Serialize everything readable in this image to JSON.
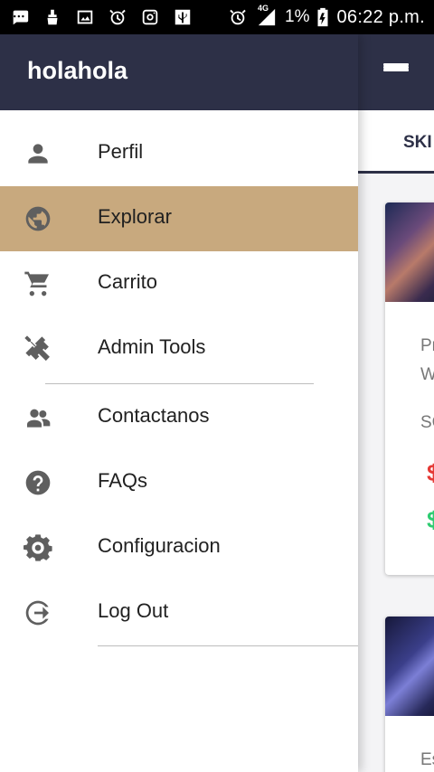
{
  "status_bar": {
    "network": "4G",
    "battery": "1%",
    "time": "06:22 p.m."
  },
  "drawer": {
    "title": "holahola",
    "items": [
      {
        "label": "Perfil",
        "icon": "person-icon"
      },
      {
        "label": "Explorar",
        "icon": "globe-icon",
        "active": true
      },
      {
        "label": "Carrito",
        "icon": "cart-icon"
      },
      {
        "label": "Admin Tools",
        "icon": "tools-icon"
      },
      {
        "label": "Contactanos",
        "icon": "contacts-icon"
      },
      {
        "label": "FAQs",
        "icon": "help-icon"
      },
      {
        "label": "Configuracion",
        "icon": "gear-icon"
      },
      {
        "label": "Log Out",
        "icon": "logout-icon"
      }
    ]
  },
  "background": {
    "tab_label": "SKI",
    "card1": {
      "line1": "Pr",
      "line2": "W",
      "line3": "SC",
      "price_old": "$",
      "price_new": "$"
    },
    "card2": {
      "line1": "Es"
    }
  },
  "colors": {
    "primary": "#2d3047",
    "active_item": "#c8a97e",
    "price_old": "#e53935",
    "price_new": "#2ecc71"
  }
}
